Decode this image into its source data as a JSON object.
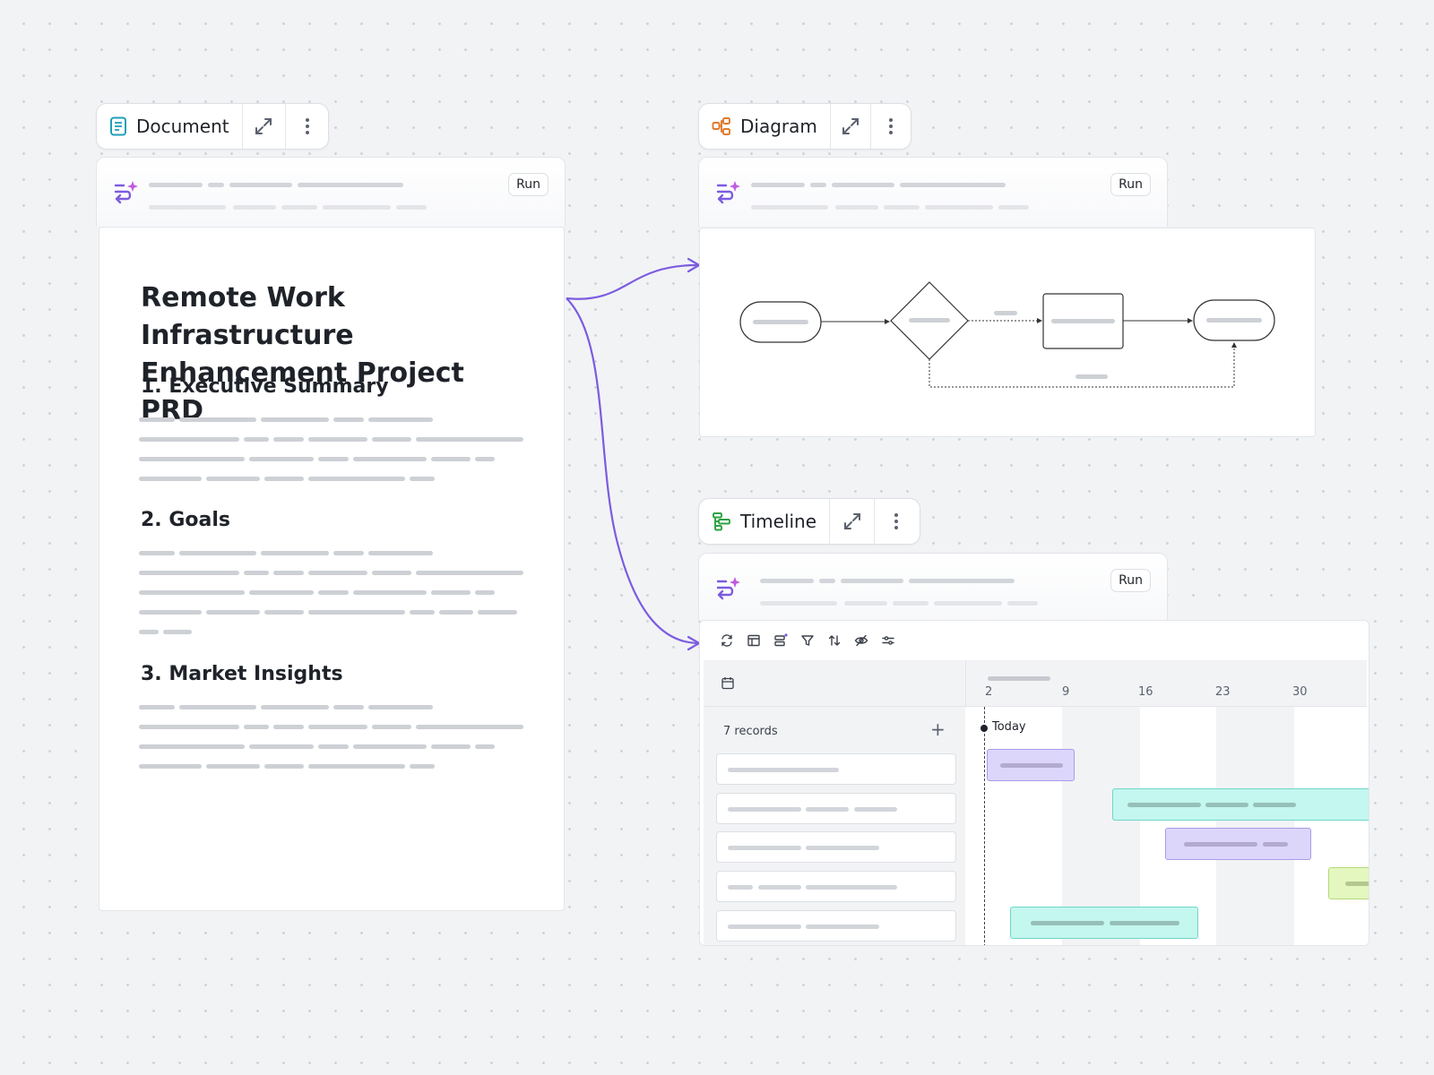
{
  "document": {
    "chip_title": "Document",
    "run_label": "Run",
    "heading": "Remote Work Infrastructure Enhancement Project PRD",
    "sections": [
      "1. Executive Summary",
      "2. Goals",
      "3. Market Insights"
    ],
    "icon": "document-icon"
  },
  "diagram": {
    "chip_title": "Diagram",
    "run_label": "Run",
    "icon": "diagram-icon"
  },
  "timeline": {
    "chip_title": "Timeline",
    "run_label": "Run",
    "icon": "timeline-icon",
    "records_label": "7 records",
    "add_symbol": "+",
    "today_label": "Today",
    "dates": [
      "2",
      "9",
      "16",
      "23",
      "30"
    ],
    "toolbar_icons": [
      "refresh-icon",
      "layout-icon",
      "group-icon",
      "filter-icon",
      "sort-icon",
      "hide-icon",
      "settings-icon"
    ]
  },
  "colors": {
    "accent": "#7b5ce0",
    "document_icon": "#1f9fb8",
    "diagram_icon": "#e07a2b",
    "timeline_icon": "#2ea043",
    "bar_purple": "#ddd6fb",
    "bar_teal": "#c3f7ef",
    "bar_lime": "#e3f7bf"
  }
}
